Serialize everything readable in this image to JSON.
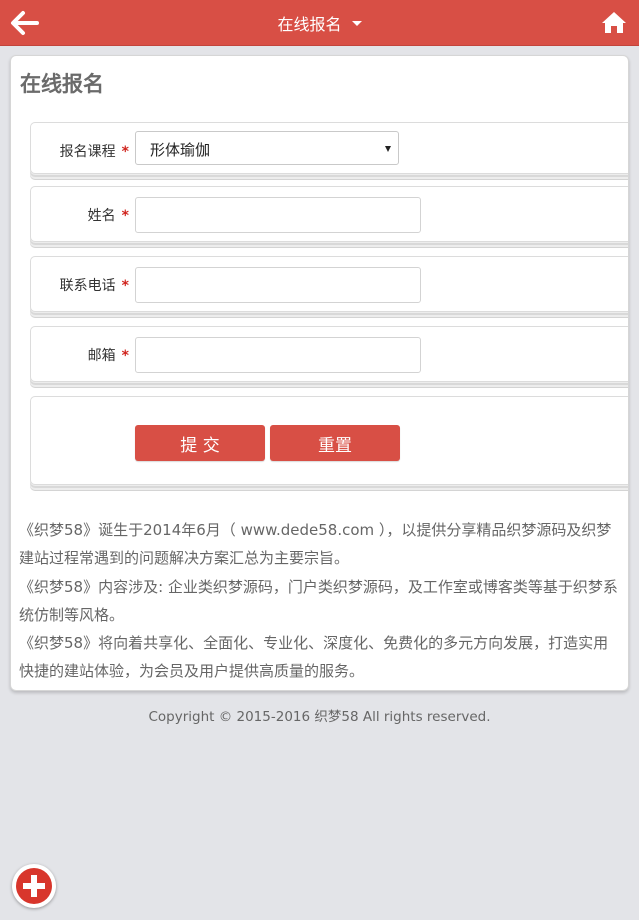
{
  "header": {
    "title": "在线报名",
    "back_icon": "arrow-left-icon",
    "home_icon": "home-icon",
    "bar_color": "#d84f45"
  },
  "form": {
    "heading": "在线报名",
    "course": {
      "label": "报名课程",
      "required_mark": "*",
      "selected_value": "形体瑜伽"
    },
    "name": {
      "label": "姓名",
      "required_mark": "*",
      "value": ""
    },
    "phone": {
      "label": "联系电话",
      "required_mark": "*",
      "value": ""
    },
    "email": {
      "label": "邮箱",
      "required_mark": "*",
      "value": ""
    },
    "submit_label": "提  交",
    "reset_label": "重置"
  },
  "description": [
    "《织梦58》诞生于2014年6月（ www.dede58.com ），以提供分享精品织梦源码及织梦建站过程常遇到的问题解决方案汇总为主要宗旨。",
    "《织梦58》内容涉及: 企业类织梦源码，门户类织梦源码，及工作室或博客类等基于织梦系统仿制等风格。",
    "《织梦58》将向着共享化、全面化、专业化、深度化、免费化的多元方向发展，打造实用快捷的建站体验，为会员及用户提供高质量的服务。"
  ],
  "footer": {
    "copyright": "Copyright © 2015-2016 织梦58 All rights reserved."
  },
  "fab": {
    "icon": "plus-icon",
    "color": "#d8362c"
  }
}
